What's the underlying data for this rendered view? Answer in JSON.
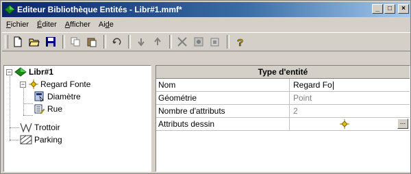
{
  "window": {
    "title": "Editeur Bibliothèque Entités - Libr#1.mmf*",
    "buttons": {
      "minimize": "_",
      "maximize": "□",
      "close": "×"
    }
  },
  "menu": [
    {
      "label": "Fichier",
      "accel": "F"
    },
    {
      "label": "Éditer",
      "accel": "É"
    },
    {
      "label": "Afficher",
      "accel": "A"
    },
    {
      "label": "Aide",
      "accel": "d"
    }
  ],
  "toolbar": {
    "buttons": [
      "new-icon",
      "open-icon",
      "save-icon",
      "copy-icon",
      "paste-icon",
      "undo-icon",
      "arrow-down-icon",
      "arrow-up-icon",
      "delete-icon",
      "properties-icon",
      "import-icon",
      "help-icon"
    ]
  },
  "tree": {
    "root": "Libr#1",
    "children": [
      {
        "label": "Regard Fonte",
        "children": [
          "Diamètre",
          "Rue"
        ]
      },
      {
        "label": "Trottoir"
      },
      {
        "label": "Parking"
      }
    ]
  },
  "grid": {
    "header": "Type d'entité",
    "rows": [
      {
        "name": "Nom",
        "value": "Regard Fo",
        "editable": true
      },
      {
        "name": "Géométrie",
        "value": "Point",
        "editable": false
      },
      {
        "name": "Nombre d'attributs",
        "value": "2",
        "editable": false
      },
      {
        "name": "Attributs dessin",
        "value": "",
        "button": "..."
      }
    ]
  },
  "colors": {
    "titlebar": "#0a246a",
    "accent_green": "#1a8a1a",
    "marker_yellow": "#e0c000"
  }
}
